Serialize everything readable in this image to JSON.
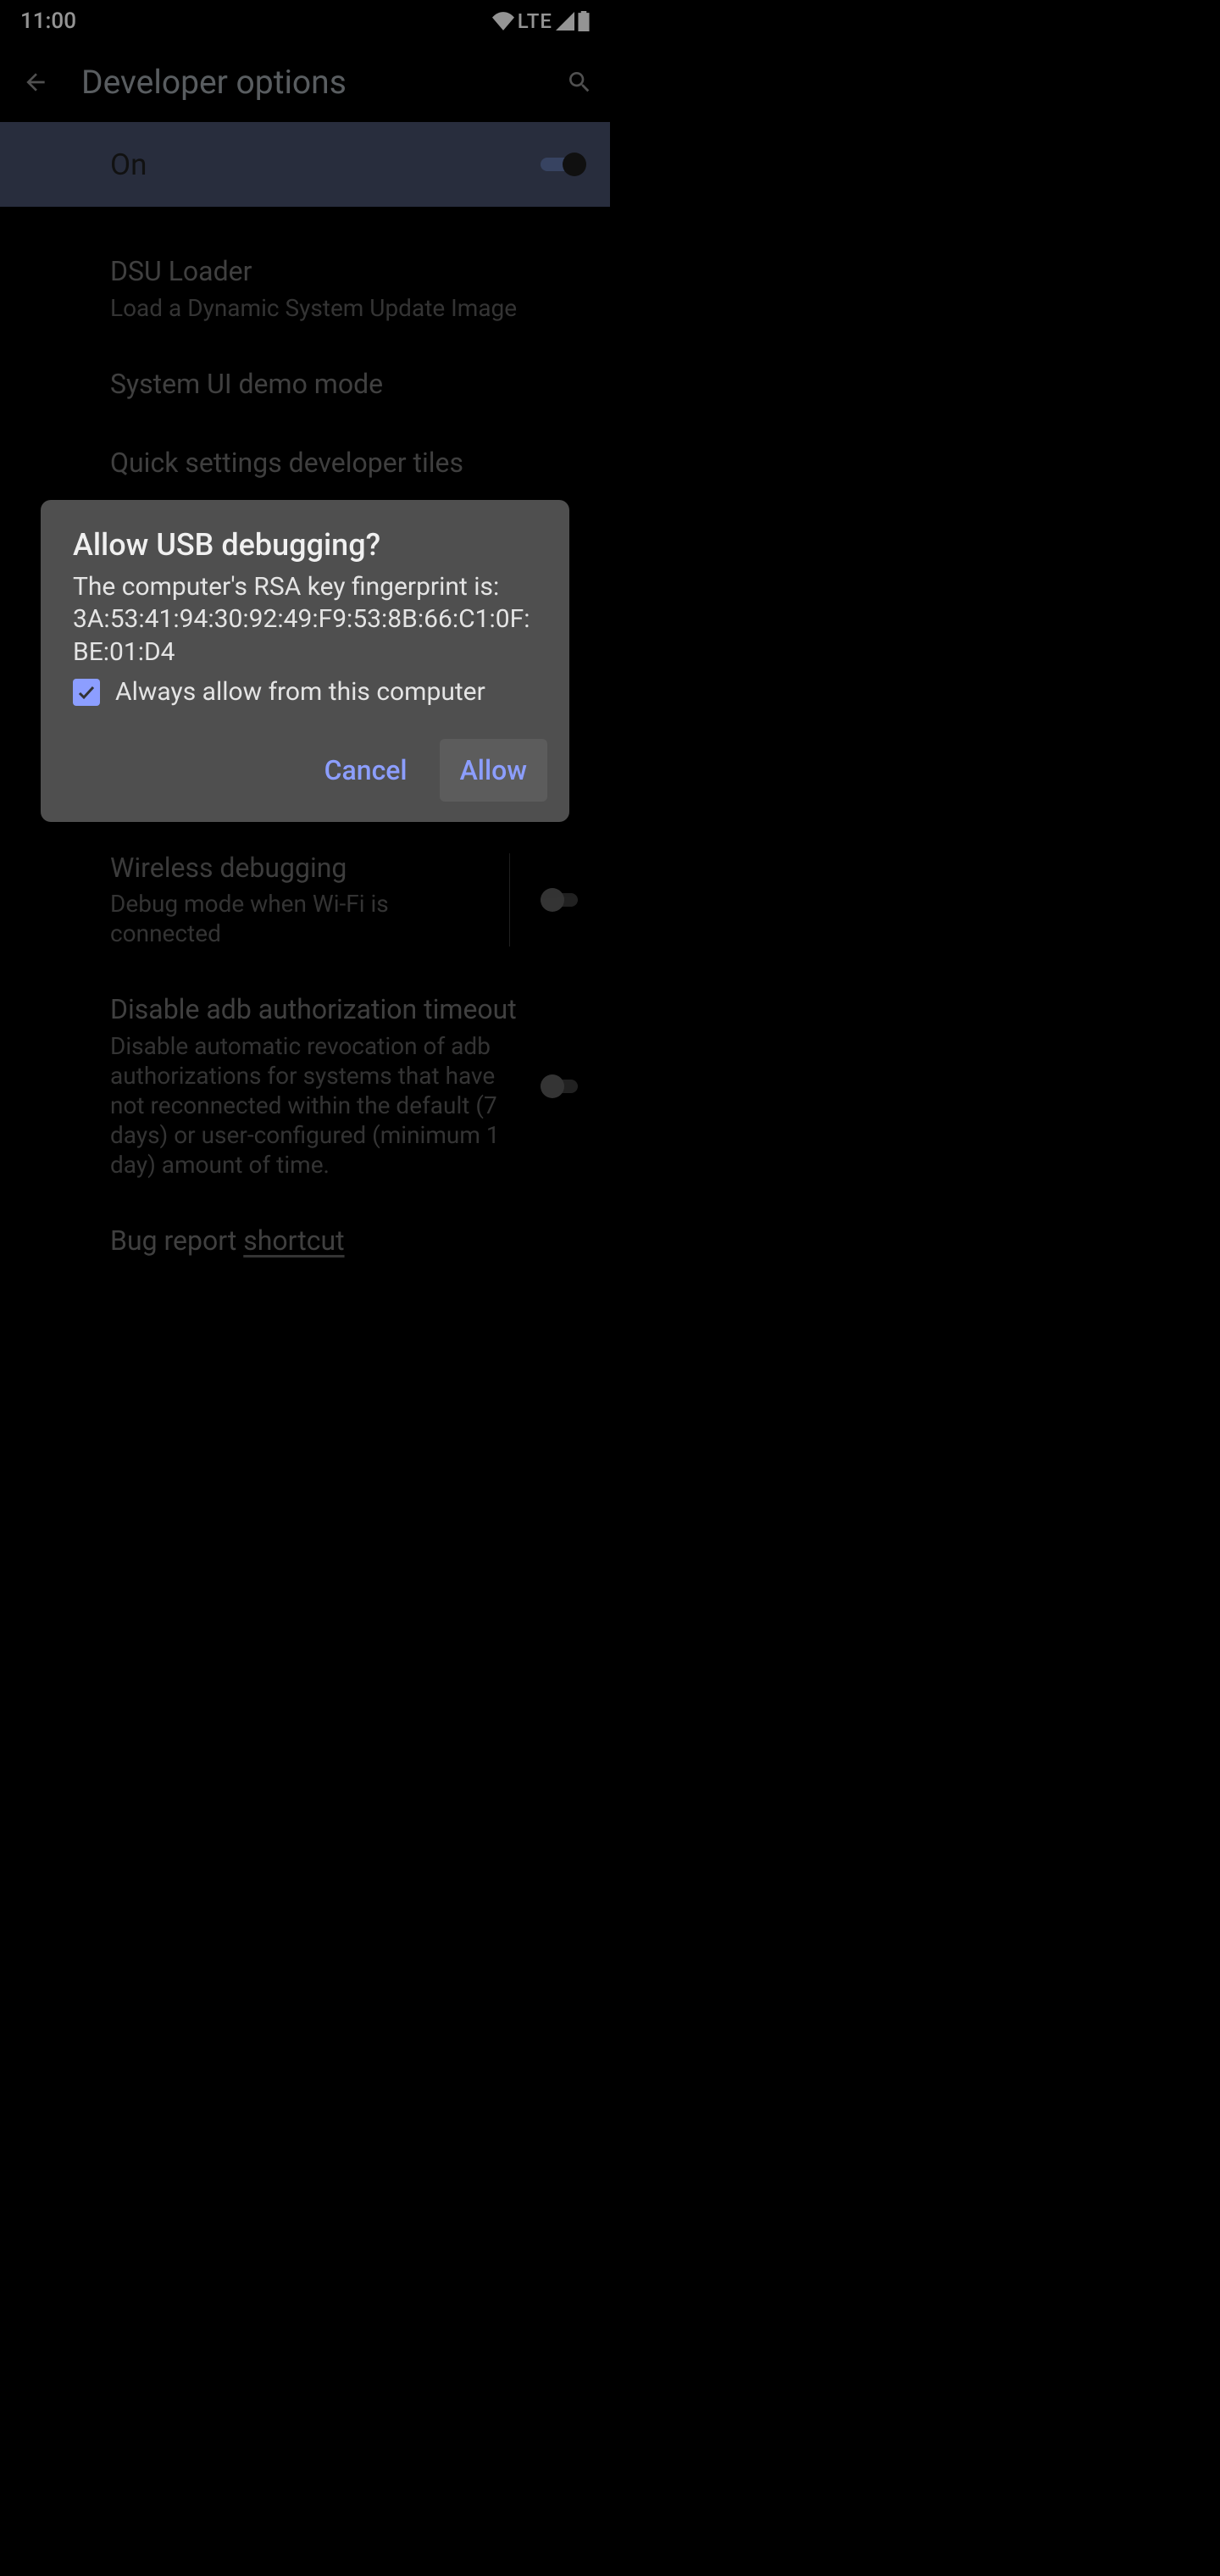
{
  "status": {
    "time": "11:00",
    "network": "LTE"
  },
  "appbar": {
    "title": "Developer options"
  },
  "master_switch": {
    "label": "On",
    "state": true
  },
  "settings": [
    {
      "title": "DSU Loader",
      "subtitle": "Load a Dynamic System Update Image"
    },
    {
      "title": "System UI demo mode"
    },
    {
      "title": "Quick settings developer tiles"
    },
    {
      "title": "Wireless debugging",
      "subtitle": "Debug mode when Wi-Fi is connected",
      "toggle": false,
      "divider": true
    },
    {
      "title": "Disable adb authorization timeout",
      "subtitle": "Disable automatic revocation of adb authorizations for systems that have not reconnected within the default (7 days) or user-configured (minimum 1 day) amount of time.",
      "toggle": false
    },
    {
      "title": "Bug report shortcut"
    }
  ],
  "dialog": {
    "title": "Allow USB debugging?",
    "message": "The computer's RSA key fingerprint is:\n3A:53:41:94:30:92:49:F9:53:8B:66:C1:0F:BE:01:D4",
    "checkbox_label": "Always allow from this computer",
    "checkbox_checked": true,
    "cancel": "Cancel",
    "confirm": "Allow"
  }
}
